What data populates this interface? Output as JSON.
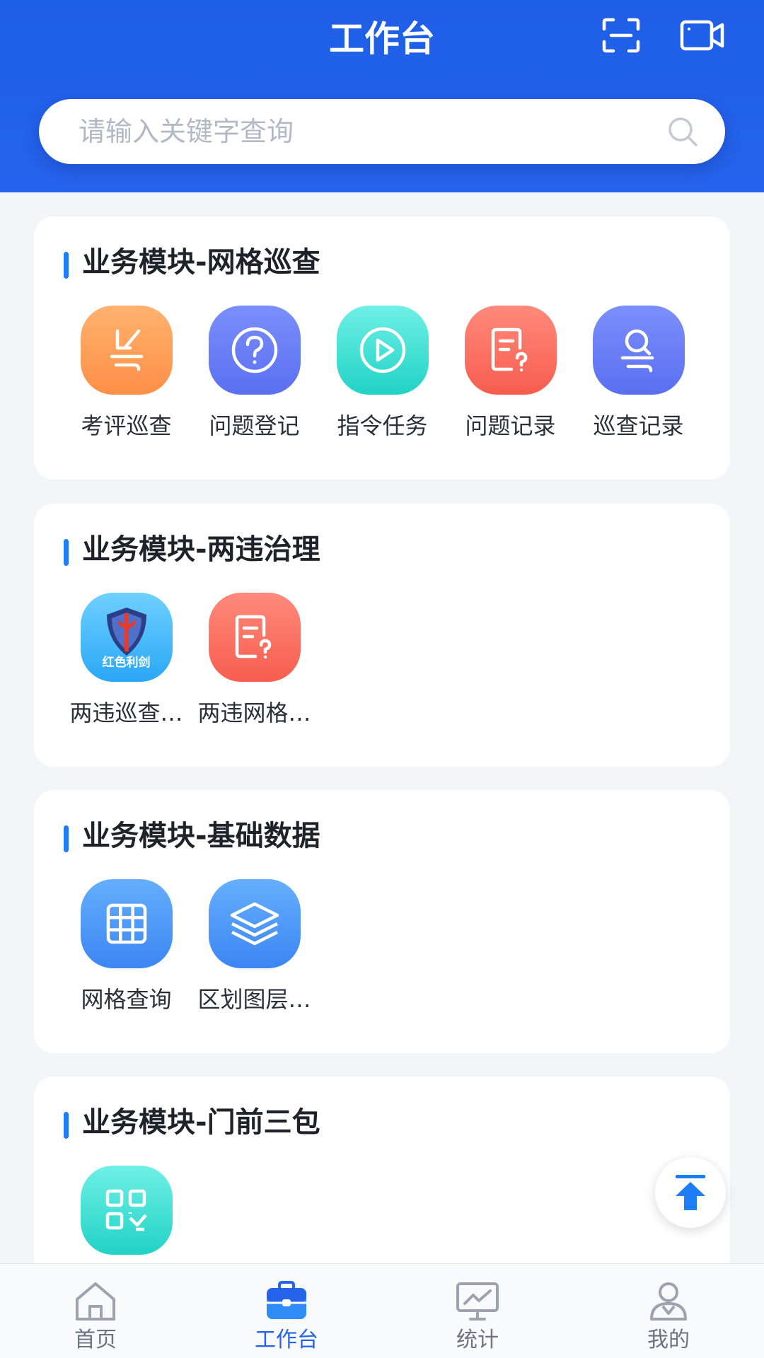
{
  "header": {
    "title": "工作台"
  },
  "search": {
    "placeholder": "请输入关键字查询"
  },
  "sections": [
    {
      "title": "业务模块-网格巡查",
      "items": [
        {
          "label": "考评巡查",
          "icon": "evaluate-patrol-icon"
        },
        {
          "label": "问题登记",
          "icon": "question-icon"
        },
        {
          "label": "指令任务",
          "icon": "play-icon"
        },
        {
          "label": "问题记录",
          "icon": "problem-record-icon"
        },
        {
          "label": "巡查记录",
          "icon": "patrol-record-icon"
        }
      ]
    },
    {
      "title": "业务模块-两违治理",
      "items": [
        {
          "label": "两违巡查…",
          "icon": "red-sword-logo-icon",
          "logo_text": "红色利剑"
        },
        {
          "label": "两违网格…",
          "icon": "problem-record-icon"
        }
      ]
    },
    {
      "title": "业务模块-基础数据",
      "items": [
        {
          "label": "网格查询",
          "icon": "grid-icon"
        },
        {
          "label": "区划图层…",
          "icon": "layers-icon"
        }
      ]
    },
    {
      "title": "业务模块-门前三包",
      "items": [
        {
          "label": "",
          "icon": "qrcode-icon"
        }
      ]
    }
  ],
  "tabbar": [
    {
      "label": "首页",
      "icon": "home-icon",
      "active": false
    },
    {
      "label": "工作台",
      "icon": "briefcase-icon",
      "active": true
    },
    {
      "label": "统计",
      "icon": "chart-icon",
      "active": false
    },
    {
      "label": "我的",
      "icon": "user-icon",
      "active": false
    }
  ],
  "colors": {
    "header_blue": "#2563eb",
    "accent_bar": "#1f7ef5",
    "active_tab": "#2563eb"
  }
}
